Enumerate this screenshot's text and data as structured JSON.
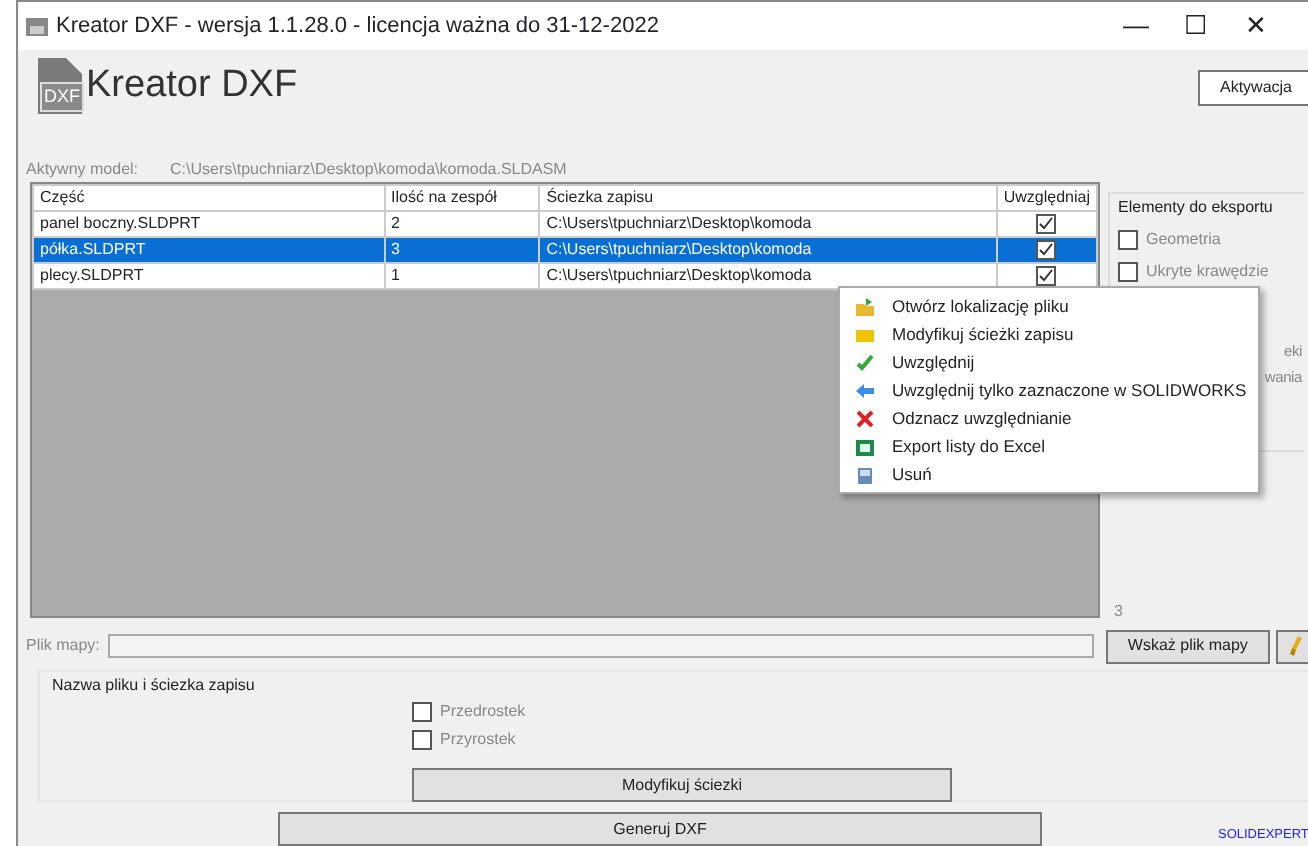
{
  "window": {
    "title": "Kreator DXF - wersja 1.1.28.0 - licencja ważna do 31-12-2022",
    "controls": [
      "—",
      "☐",
      "✕"
    ]
  },
  "logo": {
    "badge": "DXF",
    "text": "Kreator DXF"
  },
  "activation_button": "Aktywacja",
  "active_model": {
    "label": "Aktywny model:",
    "value": "C:\\Users\\tpuchniarz\\Desktop\\komoda\\komoda.SLDASM"
  },
  "table": {
    "columns": [
      "Część",
      "Ilość na zespół",
      "Ściezka zapisu",
      "Uwzględniaj"
    ],
    "rows": [
      {
        "part": "panel boczny.SLDPRT",
        "qty": "2",
        "path": "C:\\Users\\tpuchniarz\\Desktop\\komoda",
        "checked": true,
        "selected": false
      },
      {
        "part": "półka.SLDPRT",
        "qty": "3",
        "path": "C:\\Users\\tpuchniarz\\Desktop\\komoda",
        "checked": true,
        "selected": true
      },
      {
        "part": "plecy.SLDPRT",
        "qty": "1",
        "path": "C:\\Users\\tpuchniarz\\Desktop\\komoda",
        "checked": true,
        "selected": false
      }
    ]
  },
  "export_panel": {
    "title": "Elementy do eksportu",
    "options": [
      {
        "label": "Geometria",
        "checked": false
      },
      {
        "label": "Ukryte krawędzie",
        "checked": false
      }
    ],
    "partial_texts": [
      "eki",
      "wania"
    ],
    "count": "3"
  },
  "context_menu": [
    {
      "label": "Otwórz lokalizację pliku",
      "kind": "open"
    },
    {
      "label": "Modyfikuj ścieżki zapisu",
      "kind": "folder"
    },
    {
      "label": "Uwzględnij",
      "kind": "check"
    },
    {
      "label": "Uwzględnij tylko zaznaczone w SOLIDWORKS",
      "kind": "arrow"
    },
    {
      "label": "Odznacz uwzględnianie",
      "kind": "cross"
    },
    {
      "label": "Export listy do Excel",
      "kind": "excel"
    },
    {
      "label": "Usuń",
      "kind": "delete"
    }
  ],
  "map_file": {
    "label": "Plik mapy:",
    "button": "Wskaż plik mapy"
  },
  "naming_group": {
    "title": "Nazwa pliku i ściezka zapisu",
    "options": [
      {
        "label": "Przedrostek",
        "checked": false
      },
      {
        "label": "Przyrostek",
        "checked": false
      }
    ],
    "button": "Modyfikuj ściezki"
  },
  "generate_button": "Generuj DXF",
  "footer_link": "SOLIDEXPERT"
}
